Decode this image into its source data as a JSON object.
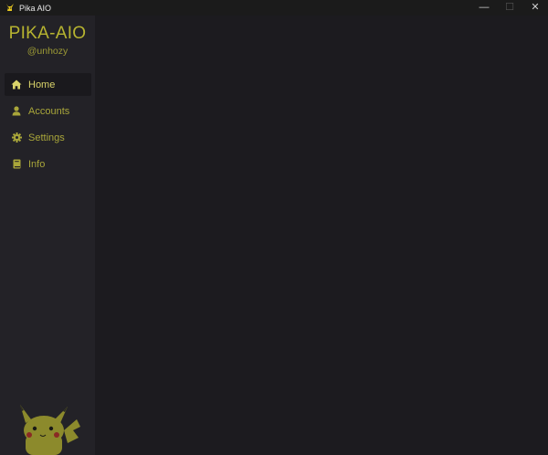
{
  "window": {
    "title": "Pika AIO",
    "controls": {
      "minimize": "—",
      "maximize": "☐",
      "close": "✕"
    }
  },
  "sidebar": {
    "brand": "PIKA-AIO",
    "handle": "@unhozy",
    "items": [
      {
        "label": "Home",
        "icon": "home-icon",
        "active": true
      },
      {
        "label": "Accounts",
        "icon": "user-icon",
        "active": false
      },
      {
        "label": "Settings",
        "icon": "gear-icon",
        "active": false
      },
      {
        "label": "Info",
        "icon": "book-icon",
        "active": false
      }
    ]
  },
  "colors": {
    "accent": "#b7b430",
    "accent_active": "#d9d36a",
    "sidebar_bg": "#232227",
    "main_bg": "#1c1b1f",
    "titlebar_bg": "#1b1b1b"
  }
}
